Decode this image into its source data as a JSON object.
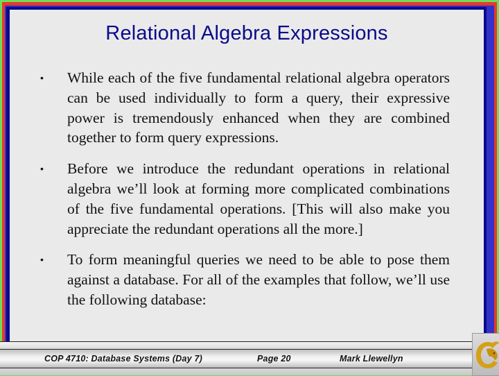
{
  "slide": {
    "title": "Relational Algebra Expressions",
    "bullets": [
      {
        "text": "While each of the five fundamental relational algebra operators can be used individually to form a query, their expressive power is tremendously enhanced when they are combined together to form query expressions."
      },
      {
        "text": "Before we introduce the redundant operations in relational algebra we’ll look at forming more complicated combinations of the five fundamental operations.  [This will also make you appreciate the redundant operations all the more.]"
      },
      {
        "text": "To form meaningful queries we need to be able to pose them against a database.  For all of the examples that follow, we’ll use the following database:"
      }
    ],
    "bullet_glyph": "•"
  },
  "footer": {
    "course": "COP 4710: Database Systems  (Day 7)",
    "page": "Page 20",
    "author": "Mark Llewellyn"
  },
  "logo": {
    "icon": "pegasus-logo-icon",
    "color": "#d4a017"
  },
  "colors": {
    "outer_border": "#6fdc5a",
    "red_border": "#e8392e",
    "blue_border": "#3232c8",
    "navy_border": "#0a0a8c",
    "title": "#0a0a8c",
    "background": "#eaeaea"
  }
}
